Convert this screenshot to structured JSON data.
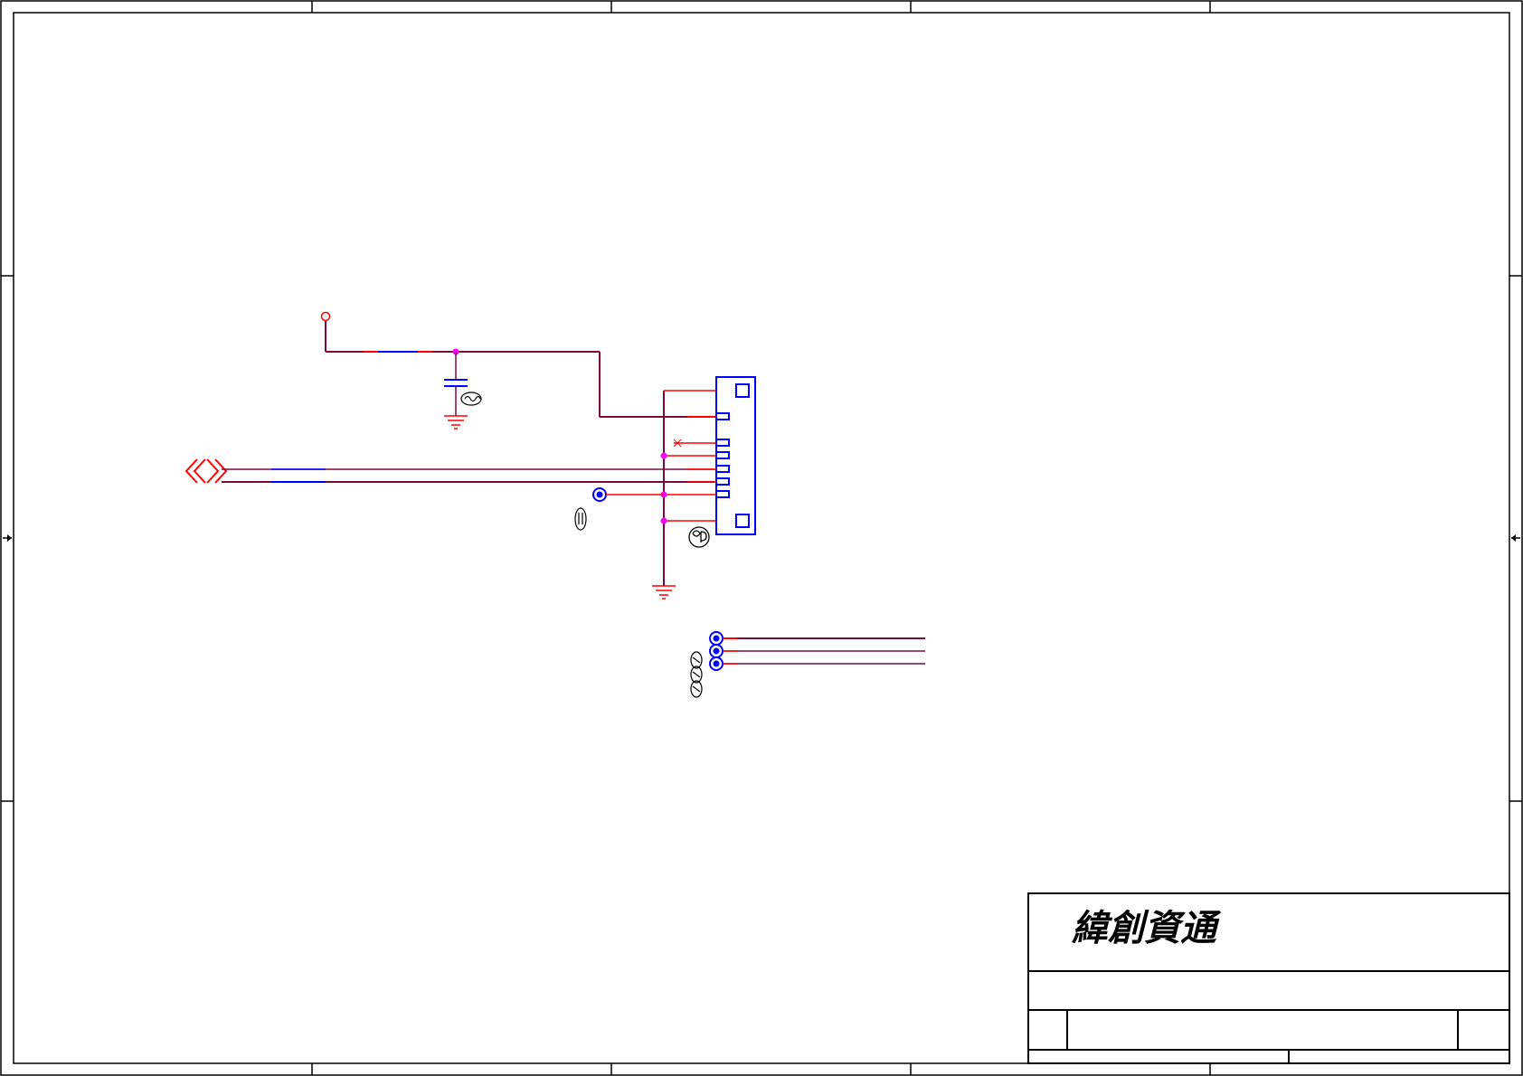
{
  "title_block": {
    "company_name": "緯創資通",
    "title": "",
    "size": "",
    "document_number": "",
    "revision": "",
    "date": "",
    "sheet": ""
  },
  "schematic": {
    "colors": {
      "border": "#000000",
      "wire": "#7a0a3a",
      "wire_accent": "#ff0000",
      "bus_highlight": "#0000ff",
      "junction": "#ff00ff",
      "component": "#0000ff",
      "port_symbol": "#ff0000",
      "ground": "#ff0000"
    },
    "symbols": [
      "power-pin-symbol",
      "capacitor-symbol",
      "ground-symbol",
      "connector-symbol",
      "off-page-connector-symbol",
      "test-point-symbol"
    ],
    "connector_pin_count": 6,
    "test_point_count": 4
  }
}
